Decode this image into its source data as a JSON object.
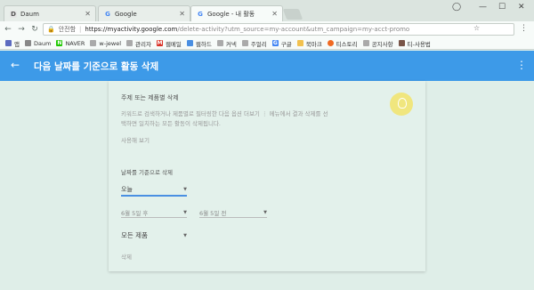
{
  "tabs": [
    {
      "label": "Daum",
      "icon": "daum-icon",
      "active": false
    },
    {
      "label": "Google",
      "icon": "google-icon",
      "active": false
    },
    {
      "label": "Google - 내 활동",
      "icon": "google-icon",
      "active": true
    }
  ],
  "address": {
    "security": "안전함",
    "domain": "https://myactivity.google.com",
    "path": "/delete-activity?utm_source=my-account&utm_campaign=my-acct-promo"
  },
  "bookmarks": [
    {
      "label": "앱",
      "color": "#5c6bc0"
    },
    {
      "label": "Daum",
      "color": "#888"
    },
    {
      "label": "NAVER",
      "color": "#1ec800"
    },
    {
      "label": "w-jewel",
      "color": "#aaa"
    },
    {
      "label": "관리자",
      "color": "#aaa"
    },
    {
      "label": "웹메일",
      "color": "#d93025"
    },
    {
      "label": "웹하드",
      "color": "#4a8fe2"
    },
    {
      "label": "커넥",
      "color": "#aaa"
    },
    {
      "label": "주얼리",
      "color": "#aaa"
    },
    {
      "label": "구글",
      "color": "#4285f4"
    },
    {
      "label": "북마크",
      "color": "#f2c14e"
    },
    {
      "label": "티스토리",
      "color": "#f06a22"
    },
    {
      "label": "공지사항",
      "color": "#aaa"
    },
    {
      "label": "티-사용법",
      "color": "#795548"
    }
  ],
  "appbar": {
    "title": "다음 날짜를 기준으로 활동 삭제"
  },
  "card": {
    "topic_heading": "주제 또는 제품별 삭제",
    "topic_desc1": "키워드로 검색하거나 제품별로 필터링한 다음 옵션 더보기 ⋮ 메뉴에서 결과 삭제를 선",
    "topic_desc2": "택하면 일치하는 모든 활동이 삭제됩니다.",
    "try_link": "사용해 보기",
    "date_heading": "날짜를 기준으로 삭제",
    "range_value": "오늘",
    "after_label": "6월 5일 후",
    "before_label": "6월 5일 전",
    "product_value": "모든 제품",
    "delete_button": "삭제"
  }
}
